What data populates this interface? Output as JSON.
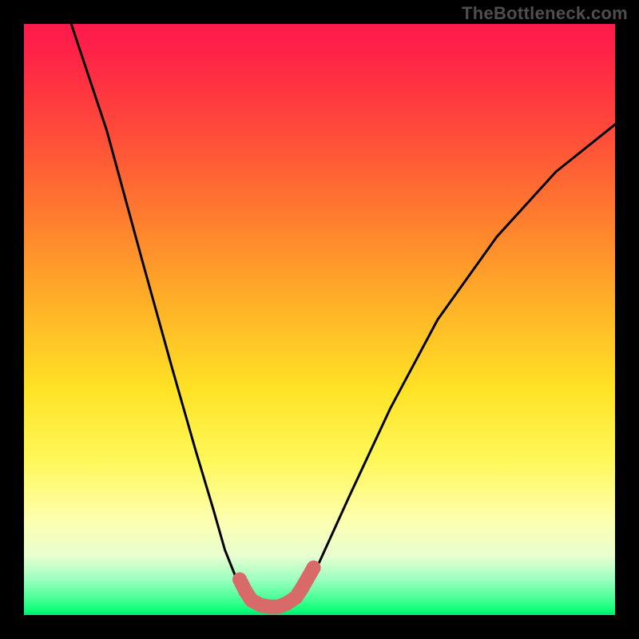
{
  "watermark": "TheBottleneck.com",
  "colors": {
    "background": "#000000",
    "curve_stroke": "#000000",
    "marker_fill": "#d86a6a",
    "gradient_top": "#ff1a4b",
    "gradient_bottom": "#00e86f"
  },
  "chart_data": {
    "type": "line",
    "title": "",
    "xlabel": "",
    "ylabel": "",
    "xlim": [
      0,
      100
    ],
    "ylim": [
      0,
      100
    ],
    "grid": false,
    "legend": false,
    "note": "values are percent of plot area; 0,0 = top-left, y increases downward",
    "series": [
      {
        "name": "left-branch",
        "values": [
          {
            "x": 8,
            "y": 0
          },
          {
            "x": 14,
            "y": 18
          },
          {
            "x": 20,
            "y": 40
          },
          {
            "x": 25,
            "y": 58
          },
          {
            "x": 29,
            "y": 72
          },
          {
            "x": 32,
            "y": 82
          },
          {
            "x": 34,
            "y": 89
          },
          {
            "x": 36,
            "y": 94
          },
          {
            "x": 37,
            "y": 96
          }
        ]
      },
      {
        "name": "valley-floor",
        "values": [
          {
            "x": 37,
            "y": 96
          },
          {
            "x": 39,
            "y": 98
          },
          {
            "x": 41,
            "y": 98.5
          },
          {
            "x": 43,
            "y": 98.5
          },
          {
            "x": 45,
            "y": 98
          },
          {
            "x": 47,
            "y": 96
          }
        ]
      },
      {
        "name": "right-branch",
        "values": [
          {
            "x": 47,
            "y": 96
          },
          {
            "x": 50,
            "y": 91
          },
          {
            "x": 55,
            "y": 80
          },
          {
            "x": 62,
            "y": 65
          },
          {
            "x": 70,
            "y": 50
          },
          {
            "x": 80,
            "y": 36
          },
          {
            "x": 90,
            "y": 25
          },
          {
            "x": 100,
            "y": 17
          }
        ]
      }
    ],
    "markers": [
      {
        "x": 36.5,
        "y": 94
      },
      {
        "x": 37.5,
        "y": 96
      },
      {
        "x": 38.5,
        "y": 97.5
      },
      {
        "x": 40,
        "y": 98.3
      },
      {
        "x": 41.5,
        "y": 98.6
      },
      {
        "x": 43,
        "y": 98.6
      },
      {
        "x": 44.5,
        "y": 98
      },
      {
        "x": 46,
        "y": 97
      },
      {
        "x": 47,
        "y": 95.5
      },
      {
        "x": 49,
        "y": 92
      }
    ]
  }
}
